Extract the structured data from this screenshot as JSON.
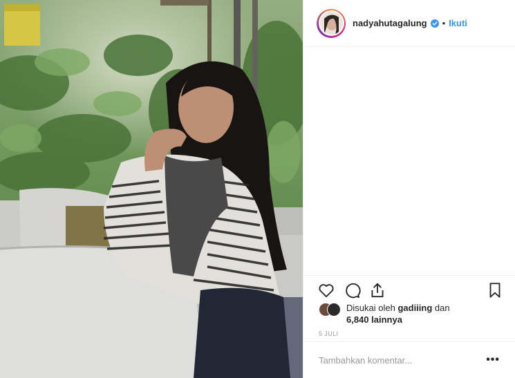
{
  "post": {
    "username": "nadyahutagalung",
    "verified_icon": "verified-badge-icon",
    "separator": "•",
    "follow_label": "Ikuti",
    "likes_prefix": "Disukai oleh",
    "liked_by": "gadiiing",
    "likes_connector": "dan",
    "likes_count": "6,840 lainnya",
    "date": "5 JULI",
    "comment_placeholder": "Tambahkan komentar...",
    "more_label": "•••"
  },
  "icons": {
    "like": "heart-icon",
    "comment": "comment-icon",
    "share": "share-icon",
    "save": "bookmark-icon"
  },
  "colors": {
    "accent": "#3897f0",
    "text": "#262626",
    "muted": "#999999",
    "border": "#efefef"
  }
}
